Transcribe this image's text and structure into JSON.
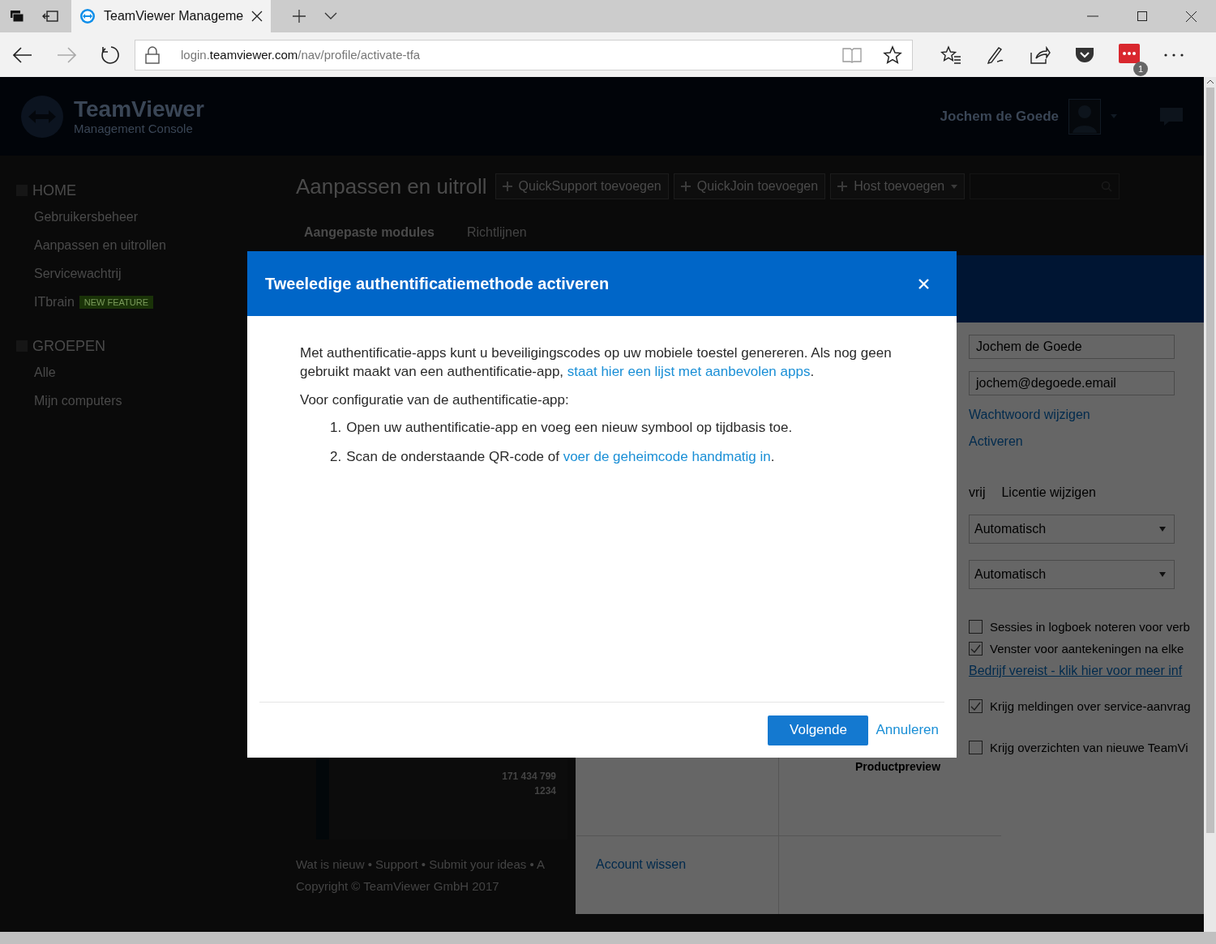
{
  "browser": {
    "tab_title": "TeamViewer Manageme",
    "url": {
      "prefix": "login.",
      "domain": "teamviewer.com",
      "path": "/nav/profile/activate-tfa"
    },
    "extension_badge": "1"
  },
  "header": {
    "brand": "TeamViewer",
    "subtitle": "Management Console",
    "user_name": "Jochem de Goede"
  },
  "sidebar": {
    "sections": [
      {
        "title": "HOME",
        "items": [
          {
            "label": "Gebruikersbeheer"
          },
          {
            "label": "Aanpassen en uitrollen"
          },
          {
            "label": "Servicewachtrij"
          },
          {
            "label": "ITbrain",
            "badge": "NEW FEATURE"
          }
        ]
      },
      {
        "title": "GROEPEN",
        "items": [
          {
            "label": "Alle"
          },
          {
            "label": "Mijn computers"
          }
        ]
      }
    ]
  },
  "main": {
    "title": "Aanpassen en uitroll",
    "actions": [
      {
        "label": "QuickSupport toevoegen",
        "caret": false
      },
      {
        "label": "QuickJoin toevoegen",
        "caret": false
      },
      {
        "label": "Host toevoegen",
        "caret": true
      }
    ],
    "tabs": [
      {
        "label": "Aangepaste modules",
        "selected": true
      },
      {
        "label": "Richtlijnen",
        "selected": false
      }
    ],
    "module_card": {
      "values": [
        "171 434 799",
        "1234"
      ]
    },
    "footer": {
      "links": "Wat is nieuw • Support • Submit your ideas • A",
      "copyright": "Copyright © TeamViewer GmbH 2017"
    }
  },
  "profile_panel": {
    "name_value": "Jochem de Goede",
    "email_value": "jochem@degoede.email",
    "password_link": "Wachtwoord wijzigen",
    "tfa_link": "Activeren",
    "license": "vrij",
    "license_link": "Licentie wijzigen",
    "selects": [
      "Automatisch",
      "Automatisch"
    ],
    "options_a": [
      {
        "label": "Sessies in logboek noteren voor verb",
        "checked": false
      },
      {
        "label": "Venster voor aantekeningen na elke",
        "checked": true
      }
    ],
    "company_link": "Bedrijf vereist - klik hier voor meer inf",
    "options_b": [
      {
        "label": "Krijg meldingen over service-aanvrag",
        "checked": true
      }
    ],
    "preview_label": "Productpreview",
    "options_c": [
      {
        "label": "Krijg overzichten van nieuwe TeamVi",
        "checked": false
      }
    ],
    "delete_link": "Account wissen"
  },
  "dialog": {
    "title": "Tweeledige authentificatiemethode activeren",
    "intro": "Met authentificatie-apps kunt u beveiligingscodes op uw mobiele toestel genereren. Als nog geen gebruikt maakt van een authentificatie-app,",
    "intro_link": "staat hier een lijst met aanbevolen apps",
    "intro_end": ".",
    "setup_heading": "Voor configuratie van de authentificatie-app:",
    "steps": [
      {
        "number": "1.",
        "text": "Open uw authentificatie-app en voeg een nieuw symbool op tijdbasis toe."
      },
      {
        "number": "2.",
        "text": "Scan de onderstaande QR-code of",
        "link": "voer de geheimcode handmatig in",
        "end": "."
      }
    ],
    "primary_button": "Volgende",
    "cancel_link": "Annuleren"
  }
}
